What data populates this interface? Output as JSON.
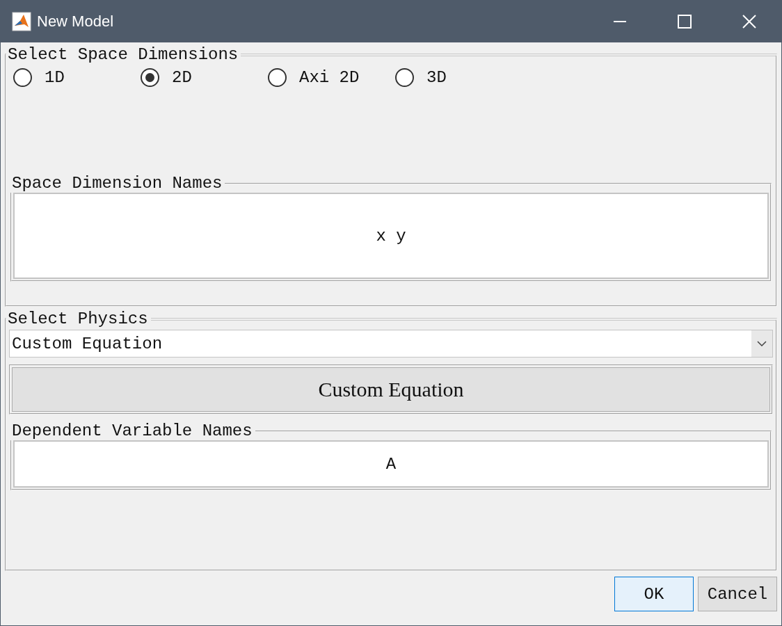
{
  "window": {
    "title": "New Model"
  },
  "space_dimensions": {
    "legend": "Select Space Dimensions",
    "options": [
      {
        "label": "1D",
        "selected": false
      },
      {
        "label": "2D",
        "selected": true
      },
      {
        "label": "Axi 2D",
        "selected": false
      },
      {
        "label": "3D",
        "selected": false
      }
    ],
    "names": {
      "legend": "Space Dimension Names",
      "value": "x y"
    }
  },
  "physics": {
    "legend": "Select Physics",
    "dropdown": {
      "value": "Custom Equation"
    },
    "button": "Custom Equation",
    "dependent": {
      "legend": "Dependent Variable Names",
      "value": "A"
    }
  },
  "buttons": [
    {
      "label": "OK",
      "default": true
    },
    {
      "label": "Cancel",
      "default": false
    }
  ]
}
